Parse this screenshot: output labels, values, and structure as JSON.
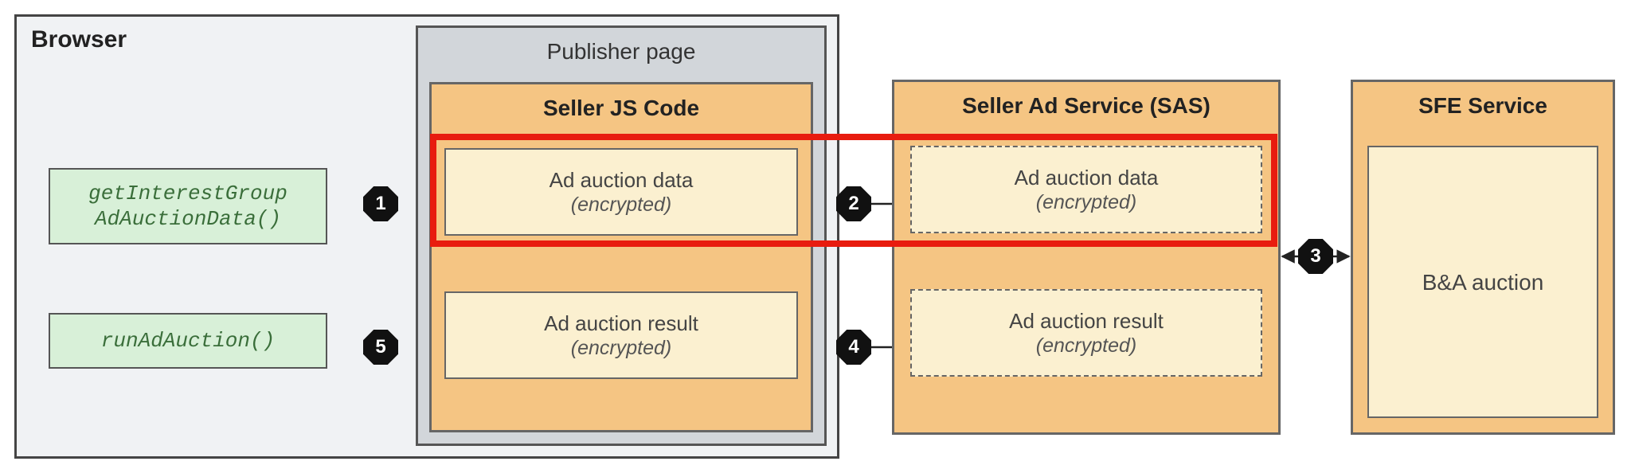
{
  "browser": {
    "label": "Browser",
    "apis": {
      "getIGData": "getInterestGroup AdAuctionData()",
      "runAdAuction": "runAdAuction()"
    }
  },
  "publisher": {
    "label": "Publisher page",
    "sellerJs": {
      "label": "Seller JS Code",
      "adData": {
        "title": "Ad auction data",
        "sub": "(encrypted)"
      },
      "adResult": {
        "title": "Ad auction result",
        "sub": "(encrypted)"
      }
    }
  },
  "sas": {
    "label": "Seller Ad Service (SAS)",
    "adData": {
      "title": "Ad auction data",
      "sub": "(encrypted)"
    },
    "adResult": {
      "title": "Ad auction result",
      "sub": "(encrypted)"
    }
  },
  "sfe": {
    "label": "SFE Service",
    "ba": "B&A auction"
  },
  "steps": {
    "s1": "1",
    "s2": "2",
    "s3": "3",
    "s4": "4",
    "s5": "5"
  }
}
